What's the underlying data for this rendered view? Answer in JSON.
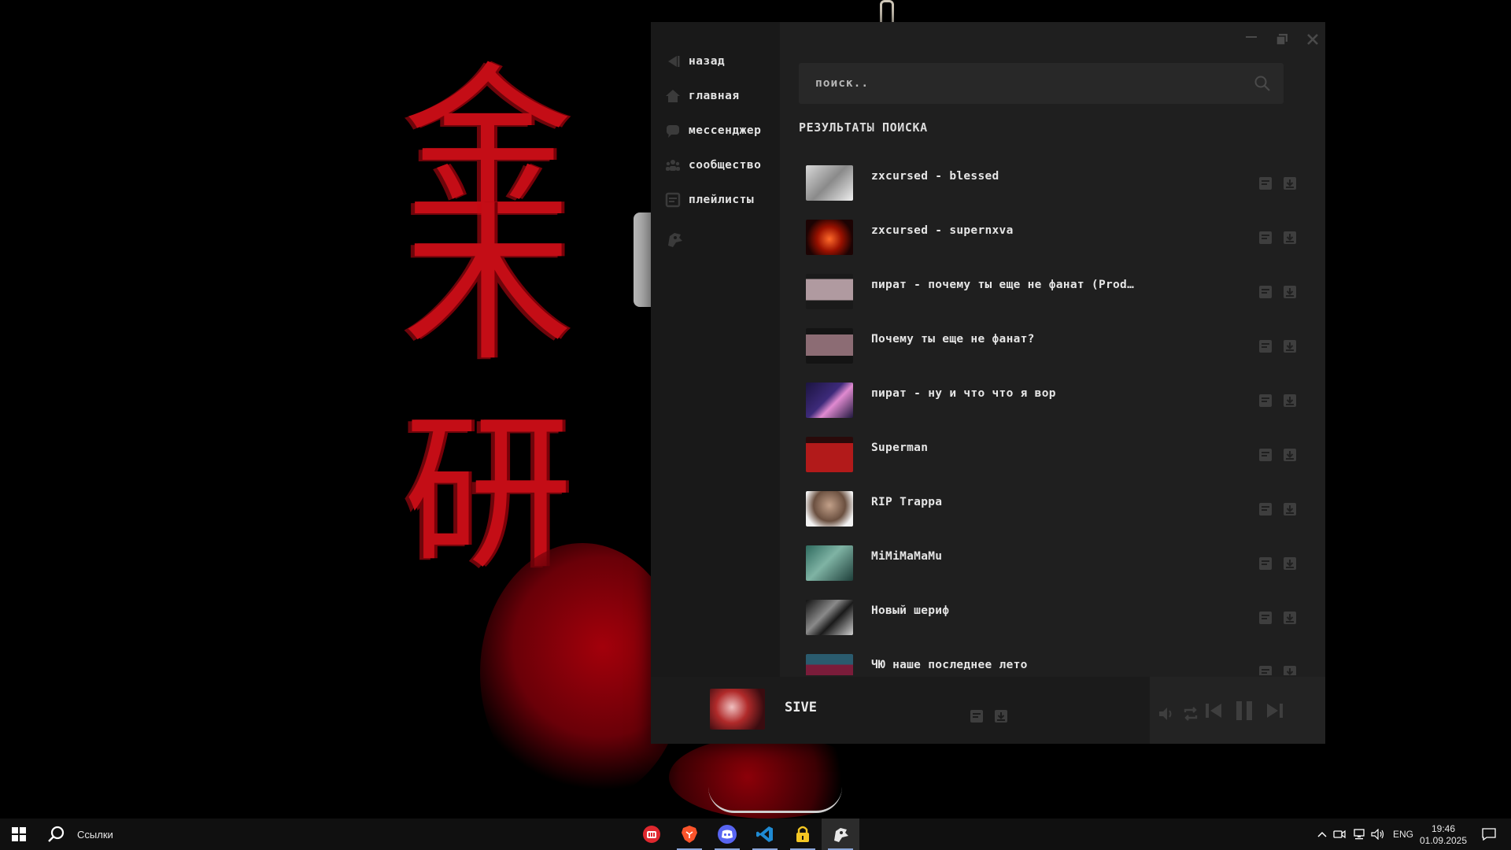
{
  "wallpaper": {
    "kanji": [
      "金",
      "木",
      "研"
    ]
  },
  "window": {
    "minimize_icon": "minimize-icon",
    "maximize_icon": "restore-icon",
    "close_icon": "close-icon"
  },
  "sidebar": {
    "items": [
      {
        "label": "назад",
        "icon": "back-icon"
      },
      {
        "label": "главная",
        "icon": "home-icon"
      },
      {
        "label": "мессенджер",
        "icon": "chat-icon"
      },
      {
        "label": "сообщество",
        "icon": "community-icon"
      },
      {
        "label": "плейлисты",
        "icon": "playlist-icon"
      }
    ],
    "logo_icon": "app-logo-icon"
  },
  "search": {
    "placeholder": "поиск..",
    "value": ""
  },
  "results": {
    "title": "РЕЗУЛЬТАТЫ ПОИСКА",
    "tracks": [
      {
        "title": "zxcursed - blessed"
      },
      {
        "title": "zxcursed - supernxva"
      },
      {
        "title": "пират - почему ты еще не фанат (Prod.IO…"
      },
      {
        "title": "Почему ты еще не фанат?"
      },
      {
        "title": "пират - ну и что что я вор"
      },
      {
        "title": "Superman"
      },
      {
        "title": "RIP Trappa"
      },
      {
        "title": "MiMiMaMaMu"
      },
      {
        "title": "Новый шериф"
      },
      {
        "title": "ЧЮ наше последнее лето"
      }
    ]
  },
  "player": {
    "title": "SIVE",
    "state": "playing"
  },
  "taskbar": {
    "search_label": "Ссылки",
    "language": "ENG",
    "time": "19:46",
    "date": "01.09.2025"
  },
  "colors": {
    "accent_red": "#c40d16",
    "window_bg": "#1f1f1f",
    "sidebar_bg": "#191919"
  }
}
